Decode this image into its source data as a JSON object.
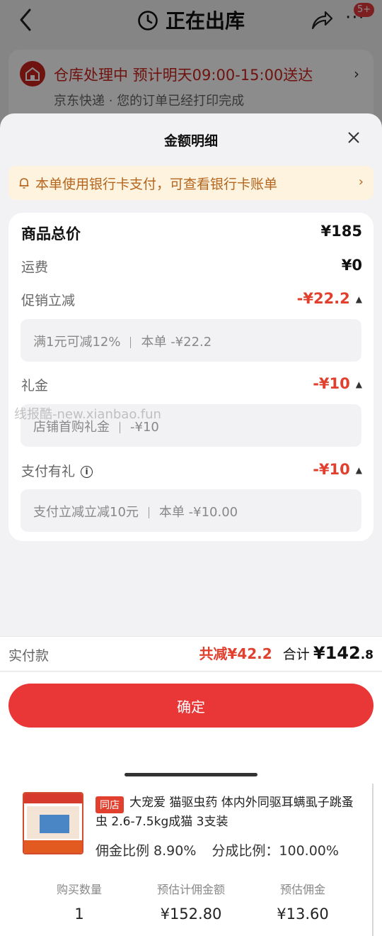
{
  "nav": {
    "title": "正在出库",
    "badge": "5+",
    "more": "···"
  },
  "status": {
    "headline": "仓库处理中 预计明天09:00-15:00送达",
    "sub": "京东快递 · 您的订单已经打印完成",
    "chevron": "›"
  },
  "sheet": {
    "title": "金额明细",
    "notice": "本单使用银行卡支付，可查看银行卡账单",
    "notice_chevron": "›",
    "rows": {
      "goods_total": {
        "label": "商品总价",
        "value": "¥185"
      },
      "shipping": {
        "label": "运费",
        "value": "¥0"
      },
      "promo": {
        "label": "促销立减",
        "value": "-¥22.2",
        "detail_a": "满1元可减12%",
        "detail_b": "本单 -¥22.2"
      },
      "gift": {
        "label": "礼金",
        "value": "-¥10",
        "detail_a": "店铺首购礼金",
        "detail_b": "-¥10"
      },
      "pay_gift": {
        "label": "支付有礼",
        "value": "-¥10",
        "detail_a": "支付立减立减10元",
        "detail_b": "本单 -¥10.00"
      }
    },
    "watermark": "线报酷-new.xianbao.fun",
    "footer": {
      "paid_label": "实付款",
      "discount": "共减¥42.2",
      "total_label": "合计",
      "total_value": "¥142",
      "total_decimal": ".8"
    },
    "confirm_label": "确定"
  },
  "product": {
    "tag": "同店",
    "title": "大宠爱 猫驱虫药 体内外同驱耳螨虱子跳蚤虫 2.6-7.5kg成猫 3支装",
    "commission_rate": "佣金比例 8.90%",
    "share_rate": "分成比例：100.00%",
    "stats": [
      {
        "label": "购买数量",
        "value": "1"
      },
      {
        "label": "预估计佣金额",
        "value": "¥152.80"
      },
      {
        "label": "预估佣金",
        "value": "¥13.60"
      }
    ]
  },
  "colors": {
    "accent_red": "#e93636",
    "discount_red": "#e2402e",
    "notice_bg": "#fdf3de",
    "notice_text": "#b5651d"
  }
}
